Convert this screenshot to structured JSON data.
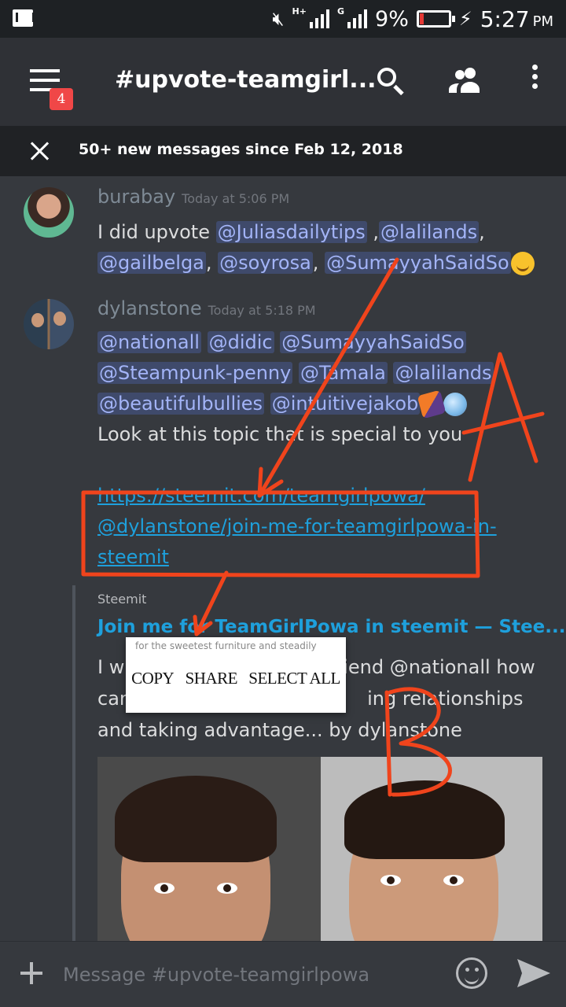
{
  "status_bar": {
    "battery": "9%",
    "time": "5:27",
    "ampm": "PM",
    "network_tag_1": "H+",
    "network_tag_2": "G"
  },
  "toolbar": {
    "channel_title": "#upvote-teamgirl...",
    "notification_count": "4"
  },
  "new_messages_bar": {
    "text": "50+ new messages since Feb 12, 2018"
  },
  "messages": [
    {
      "author": "burabay",
      "timestamp": "Today at 5:06 PM",
      "line1_prefix": "I did upvote ",
      "mentions": [
        "@Juliasdailytips",
        "@lalilands",
        "@gailbelga",
        "@soyrosa",
        "@SumayyahSaidSo"
      ],
      "sep": ",",
      "emoji": "smiling-face-emoji"
    },
    {
      "author": "dylanstone",
      "timestamp": "Today at 5:18 PM",
      "mentions": [
        "@nationall",
        "@didic",
        "@SumayyahSaidSo",
        "@Steampunk-penny",
        "@Tamala",
        "@lalilands",
        "@beautifulbullies",
        "@intuitivejakob"
      ],
      "text": "Look at this topic that is special to you",
      "link_line1": "https://steemit.com/teamgirlpowa/",
      "link_line2": "@dylanstone/join-me-for-teamgirlpowa-in-",
      "link_line3": "steemit"
    }
  ],
  "embed": {
    "provider": "Steemit",
    "title": "Join me for TeamGirlPowa in steemit — Stee...",
    "desc_line1_start": "I w",
    "desc_line1_end": "riend @nationall how",
    "desc_line2_start": "can",
    "desc_line2_end": "ing relationships",
    "desc_line3": "and taking advantage... by dylanstone",
    "image_alt": "two faces photo"
  },
  "context_menu": {
    "clipped_text": "for the sweetest furniture and steadily",
    "items": [
      "COPY",
      "SHARE",
      "SELECT ALL"
    ]
  },
  "annotations": {
    "label_a": "A",
    "label_b": "B",
    "color": "#f0441c"
  },
  "composer": {
    "placeholder": "Message #upvote-teamgirlpowa"
  }
}
